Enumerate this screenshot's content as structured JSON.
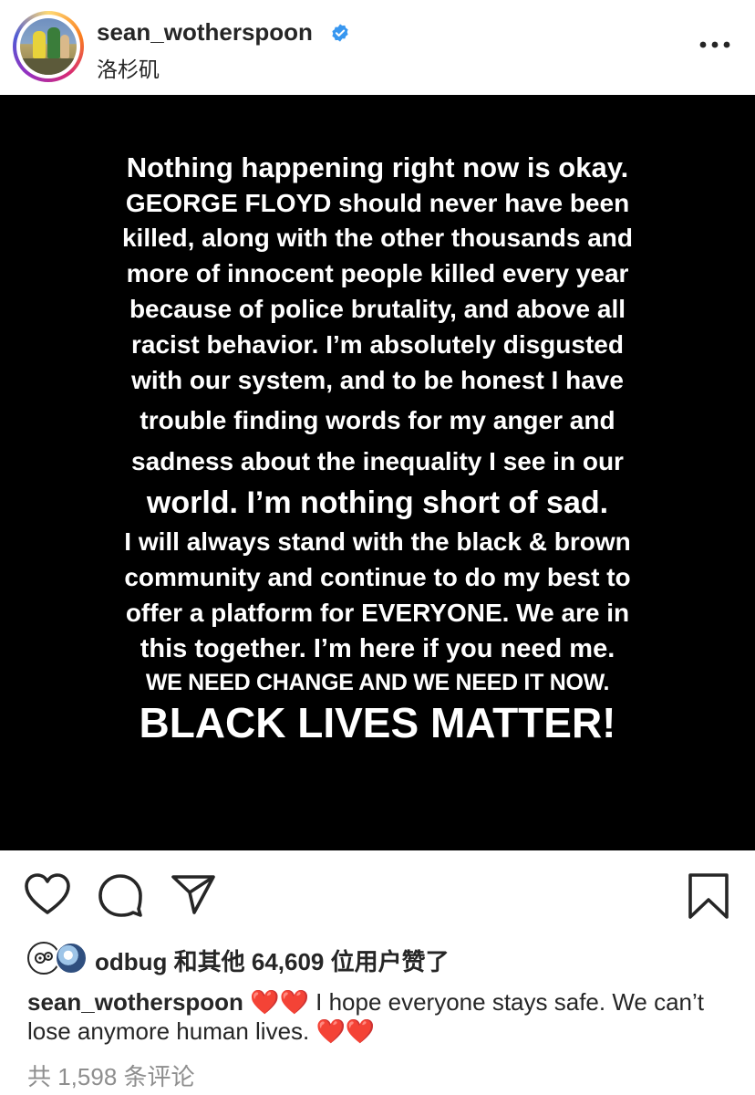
{
  "header": {
    "username": "sean_wotherspoon",
    "location": "洛杉矶"
  },
  "post": {
    "lines": [
      "Nothing happening right now is okay.",
      "GEORGE FLOYD should never have been",
      "killed, along with the other thousands and",
      "more of innocent people killed every year",
      "because of police brutality, and above all",
      "racist behavior. I’m absolutely disgusted",
      "with our system, and to be honest I have",
      "trouble finding words for my anger and",
      "sadness about the inequality I see in our",
      "world. I’m nothing short of sad.",
      "I will always stand with the black & brown",
      "community and continue to do my best to",
      "offer a platform for EVERYONE. We are in",
      "this together. I’m here if you need me.",
      "WE NEED CHANGE AND WE NEED IT NOW.",
      "BLACK LIVES MATTER!"
    ]
  },
  "likes": {
    "text": "odbug 和其他 64,609 位用户赞了"
  },
  "caption": {
    "username": "sean_wotherspoon",
    "text": " ❤️❤️ I hope everyone stays safe. We can’t lose anymore human lives. ❤️❤️"
  },
  "comments": {
    "link": "共 1,598 条评论"
  },
  "colors": {
    "verified": "#3897f0",
    "text": "#262626",
    "muted": "#8e8e8e",
    "post_background": "#000000"
  },
  "icons": [
    "verified-badge-icon",
    "more-options-icon",
    "heart-icon",
    "comment-icon",
    "share-icon",
    "bookmark-icon"
  ]
}
